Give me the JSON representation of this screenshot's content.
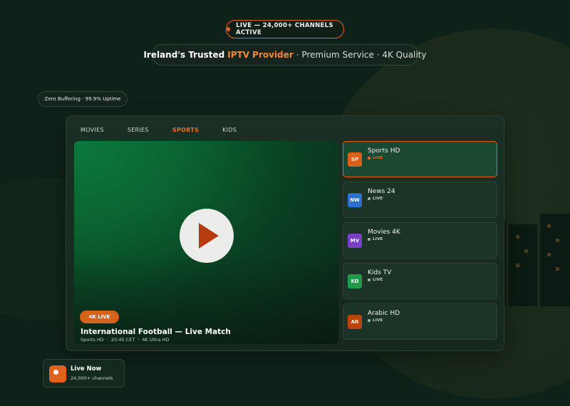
{
  "top_pill": {
    "text": "LIVE — 24,000+ CHANNELS ACTIVE",
    "dot_color": "#e2621b"
  },
  "tagline": {
    "part1": "Ireland's Trusted",
    "accent": "IPTV Provider",
    "part2": "· Premium Service · 4K Quality",
    "accent_color": "#f08a3e"
  },
  "uptime_badge": "Zero Buffering · 99.9% Uptime",
  "tabs": [
    {
      "label": "MOVIES",
      "active": false
    },
    {
      "label": "SERIES",
      "active": false
    },
    {
      "label": "SPORTS",
      "active": true
    },
    {
      "label": "KIDS",
      "active": false
    }
  ],
  "player": {
    "badge": "4K LIVE",
    "title": "International Football — Live Match",
    "meta": [
      "Sports HD",
      "·",
      "20:45 CET",
      "·",
      "4K Ultra HD"
    ],
    "play_icon": "play-icon"
  },
  "channels": [
    {
      "code": "SP",
      "name": "Sports HD",
      "status": "LIVE",
      "color": "#d9621b",
      "selected": true
    },
    {
      "code": "NW",
      "name": "News 24",
      "status": "LIVE",
      "color": "#2f6fd1",
      "selected": false
    },
    {
      "code": "MV",
      "name": "Movies 4K",
      "status": "LIVE",
      "color": "#7a3fc4",
      "selected": false
    },
    {
      "code": "KD",
      "name": "Kids TV",
      "status": "LIVE",
      "color": "#1f9a4a",
      "selected": false
    },
    {
      "code": "AR",
      "name": "Arabic HD",
      "status": "LIVE",
      "color": "#b8460c",
      "selected": false
    }
  ],
  "live_now": {
    "title": "Live Now",
    "subtitle": "24,000+ channels",
    "icon": "live-dot-icon"
  },
  "colors": {
    "accent": "#e2621b",
    "background": "#0f2219",
    "card": "#1b2f24"
  }
}
